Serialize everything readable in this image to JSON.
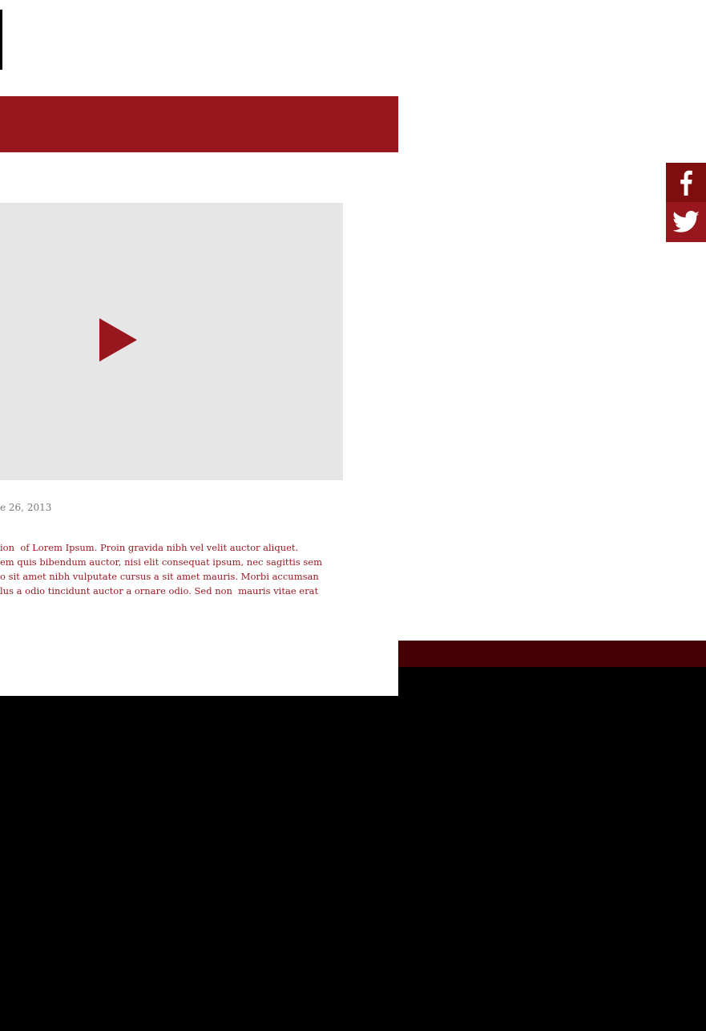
{
  "header": {
    "logo_mark_icon": "vertical-bar-mark"
  },
  "video": {
    "play_icon": "play-icon"
  },
  "post": {
    "date": "e 26, 2013",
    "body_lines": [
      "ion  of Lorem Ipsum. Proin gravida nibh vel velit auctor aliquet.",
      "em quis bibendum auctor, nisi elit consequat ipsum, nec sagittis sem",
      "o sit amet nibh vulputate cursus a sit amet mauris. Morbi accumsan",
      "lus a odio tincidunt auctor a ornare odio. Sed non  mauris vitae erat"
    ]
  },
  "social": {
    "facebook_icon": "facebook-icon",
    "twitter_icon": "twitter-icon"
  },
  "colors": {
    "brand_red": "#98171e",
    "dark_red": "#440003",
    "facebook_bg": "#7f0d10",
    "video_bg": "#e6e6e6",
    "date_gray": "#7a7a7a",
    "footer_black": "#000000"
  }
}
